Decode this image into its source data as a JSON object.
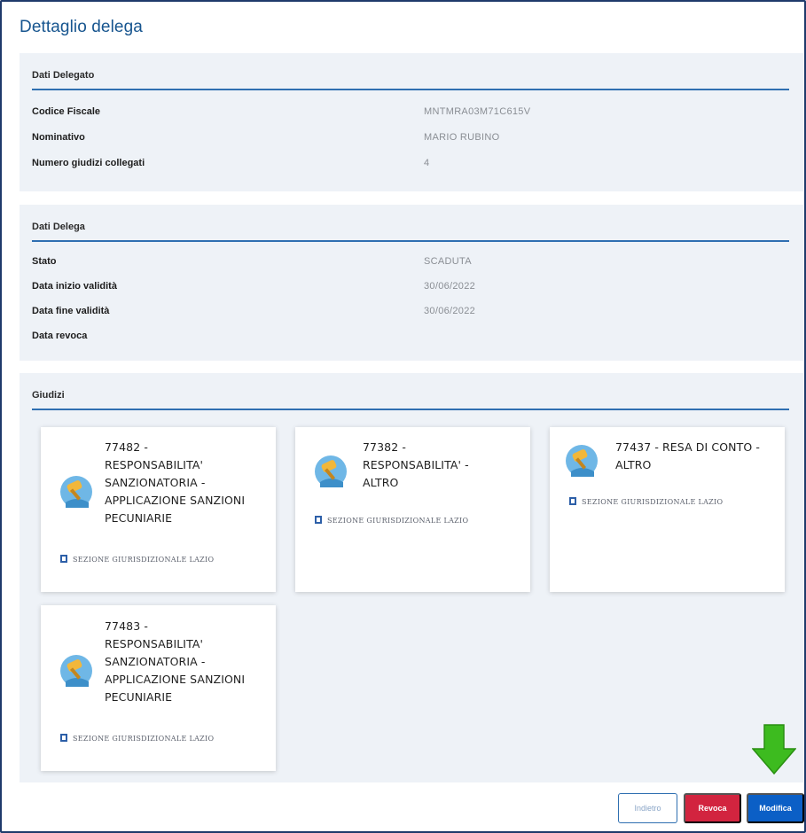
{
  "page_title": "Dettaglio delega",
  "delegato": {
    "heading": "Dati Delegato",
    "rows": [
      {
        "label": "Codice Fiscale",
        "value": "MNTMRA03M71C615V"
      },
      {
        "label": "Nominativo",
        "value": "MARIO RUBINO"
      },
      {
        "label": "Numero giudizi collegati",
        "value": "4"
      }
    ]
  },
  "delega": {
    "heading": "Dati Delega",
    "rows": [
      {
        "label": "Stato",
        "value": "SCADUTA"
      },
      {
        "label": "Data inizio validità",
        "value": "30/06/2022"
      },
      {
        "label": "Data fine validità",
        "value": "30/06/2022"
      },
      {
        "label": "Data revoca",
        "value": ""
      }
    ]
  },
  "giudizi": {
    "heading": "Giudizi",
    "cards": [
      {
        "title_lines": [
          "77482 -",
          "RESPONSABILITA'",
          "SANZIONATORIA -",
          "APPLICAZIONE SANZIONI",
          "PECUNIARIE"
        ],
        "sezione": "SEZIONE GIURISDIZIONALE LAZIO"
      },
      {
        "title_lines": [
          "77382 -",
          "RESPONSABILITA' -",
          "ALTRO"
        ],
        "sezione": "SEZIONE GIURISDIZIONALE LAZIO"
      },
      {
        "title_lines": [
          "77437 - RESA DI CONTO -",
          "ALTRO"
        ],
        "sezione": "SEZIONE GIURISDIZIONALE LAZIO"
      },
      {
        "title_lines": [
          "77483 -",
          "RESPONSABILITA'",
          "SANZIONATORIA -",
          "APPLICAZIONE SANZIONI",
          "PECUNIARIE"
        ],
        "sezione": "SEZIONE GIURISDIZIONALE LAZIO"
      }
    ]
  },
  "buttons": {
    "back": "Indietro",
    "revoca": "Revoca",
    "modifica": "Modifica"
  },
  "colors": {
    "accent": "#2f6fb1",
    "revoca": "#d2243f",
    "modifica": "#0b5fc6",
    "arrow": "#3dbb1f"
  }
}
